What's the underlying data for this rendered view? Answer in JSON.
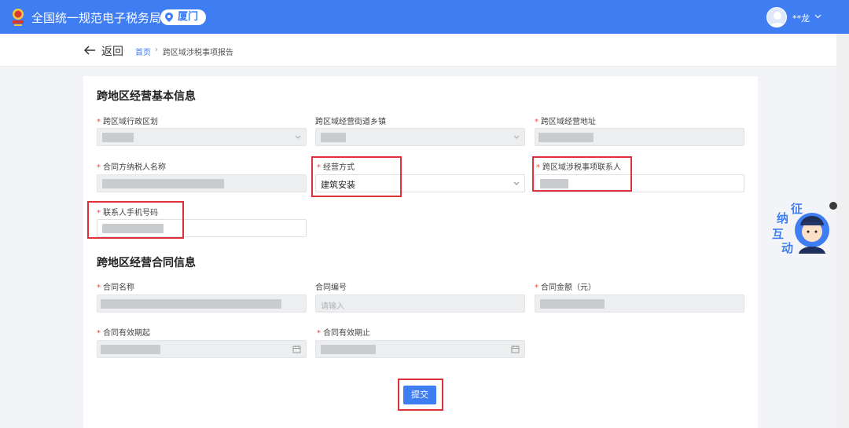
{
  "header": {
    "app_title": "全国统一规范电子税务局",
    "region": "厦门",
    "user_name": "**龙",
    "brand_color": "#3f7df2"
  },
  "subnav": {
    "back_label": "返回",
    "breadcrumb": [
      "首页",
      "跨区域涉税事项报告"
    ]
  },
  "section1": {
    "title": "跨地区经营基本信息",
    "fields": [
      {
        "label": "跨区域行政区划",
        "required": true,
        "type": "select",
        "disabled": true,
        "value": ""
      },
      {
        "label": "跨区域经营街道乡镇",
        "required": false,
        "type": "select",
        "disabled": true,
        "value": ""
      },
      {
        "label": "跨区域经营地址",
        "required": true,
        "type": "text",
        "disabled": true,
        "value": ""
      },
      {
        "label": "合同方纳税人名称",
        "required": true,
        "type": "text",
        "disabled": true,
        "value": ""
      },
      {
        "label": "经营方式",
        "required": true,
        "type": "select",
        "disabled": false,
        "value": "建筑安装"
      },
      {
        "label": "跨区域涉税事项联系人",
        "required": true,
        "type": "text",
        "disabled": false,
        "value": ""
      },
      {
        "label": "联系人手机号码",
        "required": true,
        "type": "text",
        "disabled": false,
        "value": ""
      }
    ]
  },
  "section2": {
    "title": "跨地区经营合同信息",
    "fields": [
      {
        "label": "合同名称",
        "required": true,
        "type": "text",
        "disabled": true,
        "value": ""
      },
      {
        "label": "合同编号",
        "required": false,
        "type": "text",
        "disabled": true,
        "placeholder": "请输入"
      },
      {
        "label": "合同金额（元）",
        "required": true,
        "type": "text",
        "disabled": true,
        "value": ""
      },
      {
        "label": "合同有效期起",
        "required": true,
        "type": "date",
        "disabled": true,
        "value": ""
      },
      {
        "label": "合同有效期止",
        "required": true,
        "type": "date",
        "disabled": true,
        "value": ""
      }
    ]
  },
  "submit_label": "提交",
  "float_widget": {
    "text": [
      "征",
      "纳",
      "互",
      "动"
    ]
  },
  "icons": {
    "logo": "tax-emblem-icon",
    "location": "location-pin-icon",
    "user": "user-avatar-icon",
    "back": "arrow-left-icon",
    "select": "chevron-down-icon",
    "date": "calendar-icon"
  },
  "highlight_color": "#e0313a"
}
